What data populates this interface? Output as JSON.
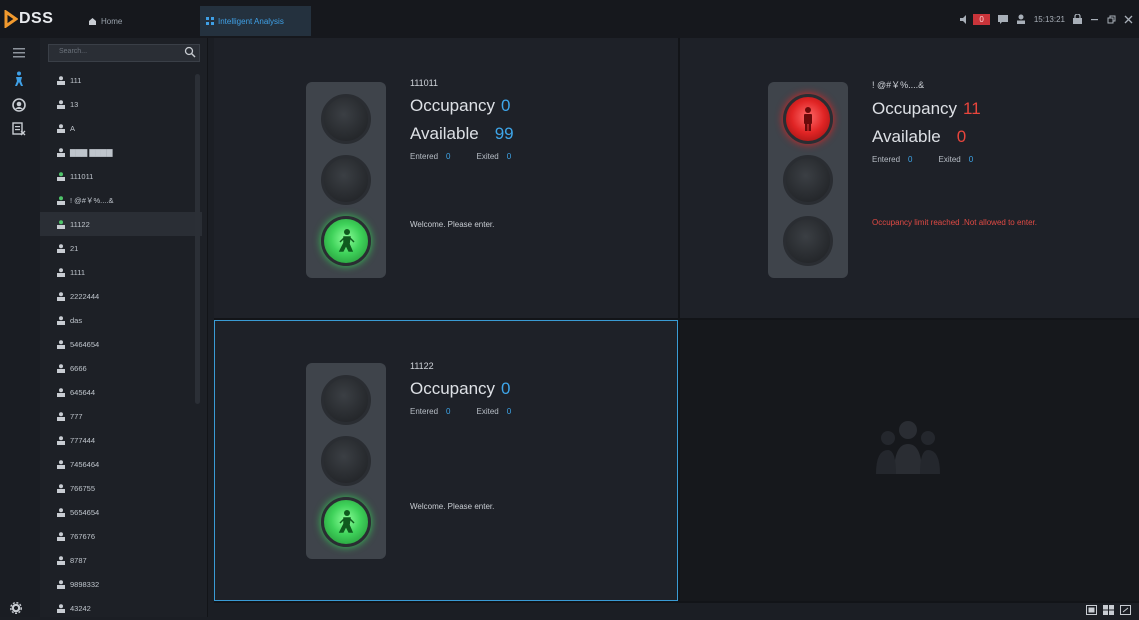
{
  "app": {
    "logo_text": "DSS"
  },
  "tabs": [
    {
      "label": "Home",
      "icon": "home-icon"
    },
    {
      "label": "Intelligent Analysis",
      "icon": "grid-icon"
    }
  ],
  "tray": {
    "alarm_count": "0",
    "time": "15:13:21"
  },
  "search": {
    "placeholder": "Search..."
  },
  "sidebar": {
    "items": [
      "111",
      "13",
      "A",
      "▇▇▇ ▇▇▇▇",
      "111011",
      "! @#￥%....&",
      "11122",
      "21",
      "1111",
      "2222444",
      "das",
      "5464654",
      "6666",
      "645644",
      "777",
      "777444",
      "7456464",
      "766755",
      "5654654",
      "767676",
      "8787",
      "9898332",
      "43242"
    ],
    "selected_index": 6
  },
  "panels": [
    {
      "name": "111011",
      "occupancy_label": "Occupancy",
      "occupancy": "0",
      "available_label": "Available",
      "available": "99",
      "entered_label": "Entered",
      "entered": "0",
      "exited_label": "Exited",
      "exited": "0",
      "message": "Welcome. Please enter.",
      "light": "green"
    },
    {
      "name": "! @#￥%....&",
      "occupancy_label": "Occupancy",
      "occupancy": "11",
      "available_label": "Available",
      "available": "0",
      "entered_label": "Entered",
      "entered": "0",
      "exited_label": "Exited",
      "exited": "0",
      "message": "Occupancy limit reached .Not allowed to enter.",
      "light": "red"
    },
    {
      "name": "11122",
      "occupancy_label": "Occupancy",
      "occupancy": "0",
      "entered_label": "Entered",
      "entered": "0",
      "exited_label": "Exited",
      "exited": "0",
      "message": "Welcome. Please enter.",
      "light": "green"
    }
  ],
  "colors": {
    "accent": "#3ea6ea",
    "alert": "#e8453c",
    "go": "#3fd25a"
  }
}
